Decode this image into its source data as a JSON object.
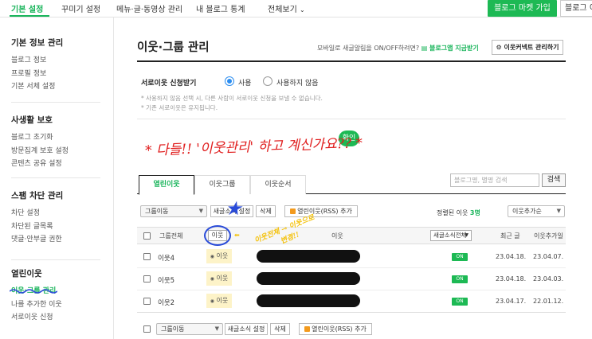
{
  "topnav": {
    "tabs": [
      "기본 설정",
      "꾸미기 설정",
      "메뉴·글·동영상 관리",
      "내 블로그 통계",
      "전체보기"
    ],
    "market_button": "블로그 마켓 가입",
    "blog_button": "블로그 이"
  },
  "sidebar": {
    "sections": [
      {
        "title": "기본 정보 관리",
        "items": [
          "블로그 정보",
          "프로필 정보",
          "기본 서체 설정"
        ]
      },
      {
        "title": "사생활 보호",
        "items": [
          "블로그 초기화",
          "방문집계 보호 설정",
          "콘텐츠 공유 설정"
        ]
      },
      {
        "title": "스팸 차단 관리",
        "items": [
          "차단 설정",
          "차단된 글목록",
          "댓글·안부글 권한"
        ]
      },
      {
        "title": "열린이웃",
        "items": [
          "이웃·그룹 관리",
          "나를 추가한 이웃",
          "서로이웃 신청"
        ]
      }
    ]
  },
  "main": {
    "title": "이웃·그룹 관리",
    "mobile_text": "모바일로 새글알림을 ON/OFF하려면?",
    "mobile_link": "블로그앱 지금받기",
    "neighbor_contents_button": "이웃커넥트 관리하기",
    "setting_label": "서로이웃 신청받기",
    "radio_yes": "사용",
    "radio_no": "사용하지 않음",
    "notes": [
      "* 사용하지 않음 선택 시, 다른 사람이 서로이웃 신청을 보낼 수 없습니다.",
      "* 기존 서로이웃은 유지됩니다."
    ],
    "confirm_blob": "확인",
    "tabs": [
      "열린이웃",
      "이웃그룹",
      "이웃순서"
    ],
    "search_placeholder": "블로그명, 별명 검색",
    "search_button": "검색",
    "toolbar": {
      "group_move": "그룹이동",
      "new_post_setting": "새글소식 설정",
      "delete": "삭제",
      "rss_add": "열린이웃(RSS) 추가",
      "sort_prefix": "정렬된 이웃",
      "sort_count": "3명",
      "sort_select": "이웃추가순"
    },
    "table": {
      "headers": {
        "group_all": "그룹전체",
        "neighbor": "이웃",
        "neighbor_col": "이웃",
        "new_post_all": "새글소식전체",
        "recent_post": "최근 글",
        "added_date": "이웃추가일"
      },
      "rows": [
        {
          "name": "이웃4",
          "group": "이웃",
          "status": "ON",
          "recent": "23.04.18.",
          "added": "23.04.07."
        },
        {
          "name": "이웃5",
          "group": "이웃",
          "status": "ON",
          "recent": "23.04.18.",
          "added": "23.04.03."
        },
        {
          "name": "이웃2",
          "group": "이웃",
          "status": "ON",
          "recent": "23.04.17.",
          "added": "22.01.12."
        }
      ]
    }
  },
  "annotations": {
    "red_note": "* 다들!! '이웃관리' 하고 계신가요?? *",
    "yellow_note_1": "이웃전체 → 이웃으로",
    "yellow_note_2": "변경!!",
    "star": "★"
  },
  "colors": {
    "accent_green": "#18b45a",
    "button_green": "#1db954",
    "annotation_red": "#e01d1d",
    "annotation_blue": "#2a4bd8",
    "annotation_yellow": "#f4c20d"
  }
}
